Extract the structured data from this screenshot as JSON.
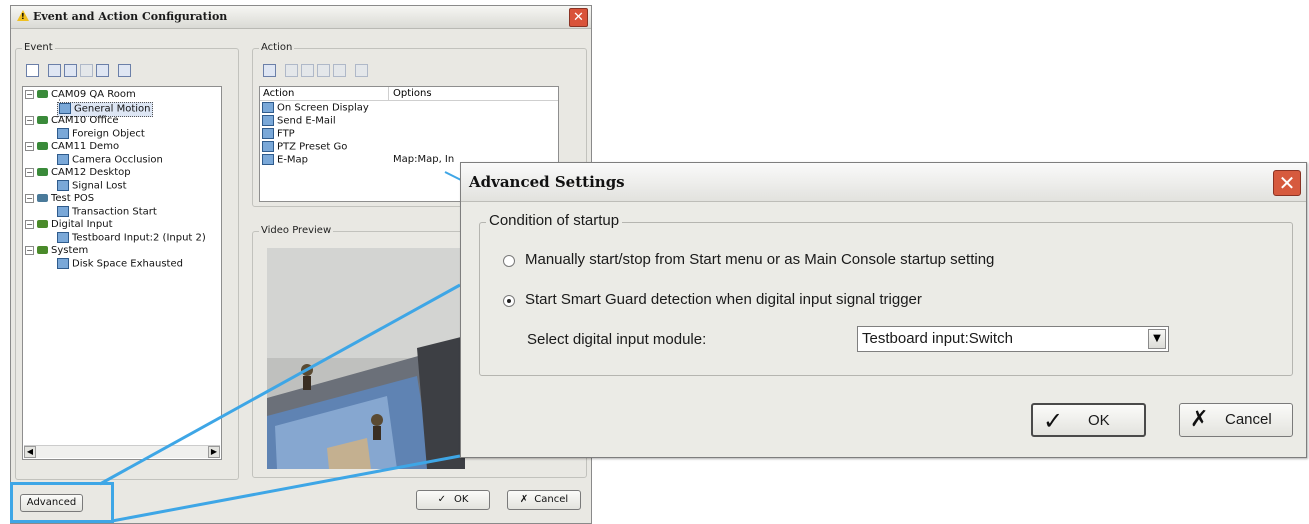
{
  "main_window": {
    "title": "Event and Action Configuration",
    "event_group_label": "Event",
    "action_group_label": "Action",
    "video_group_label": "Video Preview",
    "tree": [
      {
        "label": "CAM09 QA Room",
        "type": "camera",
        "expander": "-"
      },
      {
        "label": "General Motion",
        "type": "event",
        "selected": true
      },
      {
        "label": "CAM10 Office",
        "type": "camera",
        "expander": "-"
      },
      {
        "label": "Foreign Object",
        "type": "event"
      },
      {
        "label": "CAM11 Demo",
        "type": "camera",
        "expander": "-"
      },
      {
        "label": "Camera Occlusion",
        "type": "event"
      },
      {
        "label": "CAM12 Desktop",
        "type": "camera",
        "expander": "-"
      },
      {
        "label": "Signal Lost",
        "type": "event"
      },
      {
        "label": "Test POS",
        "type": "pos",
        "expander": "-"
      },
      {
        "label": "Transaction Start",
        "type": "event"
      },
      {
        "label": "Digital Input",
        "type": "input",
        "expander": "-"
      },
      {
        "label": "Testboard Input:2 (Input 2)",
        "type": "event"
      },
      {
        "label": "System",
        "type": "input",
        "expander": "-"
      },
      {
        "label": "Disk Space Exhausted",
        "type": "event"
      }
    ],
    "action_columns": [
      "Action",
      "Options"
    ],
    "actions": [
      {
        "name": "On Screen Display",
        "options": ""
      },
      {
        "name": "Send E-Mail",
        "options": ""
      },
      {
        "name": "FTP",
        "options": ""
      },
      {
        "name": "PTZ Preset Go",
        "options": ""
      },
      {
        "name": "E-Map",
        "options": "Map:Map, In"
      }
    ],
    "advanced_label": "Advanced",
    "ok_label": "OK",
    "cancel_label": "Cancel"
  },
  "advanced_dialog": {
    "title": "Advanced Settings",
    "group_label": "Condition of startup",
    "option_manual": "Manually start/stop from Start menu or as Main Console startup setting",
    "option_digital": "Start Smart Guard detection when digital input signal trigger",
    "selected_option": "digital",
    "module_label": "Select digital input module:",
    "module_value": "Testboard input:Switch",
    "ok_label": "OK",
    "cancel_label": "Cancel"
  },
  "colors": {
    "callout": "#3ea6e6",
    "close_button": "#d65a3e"
  }
}
